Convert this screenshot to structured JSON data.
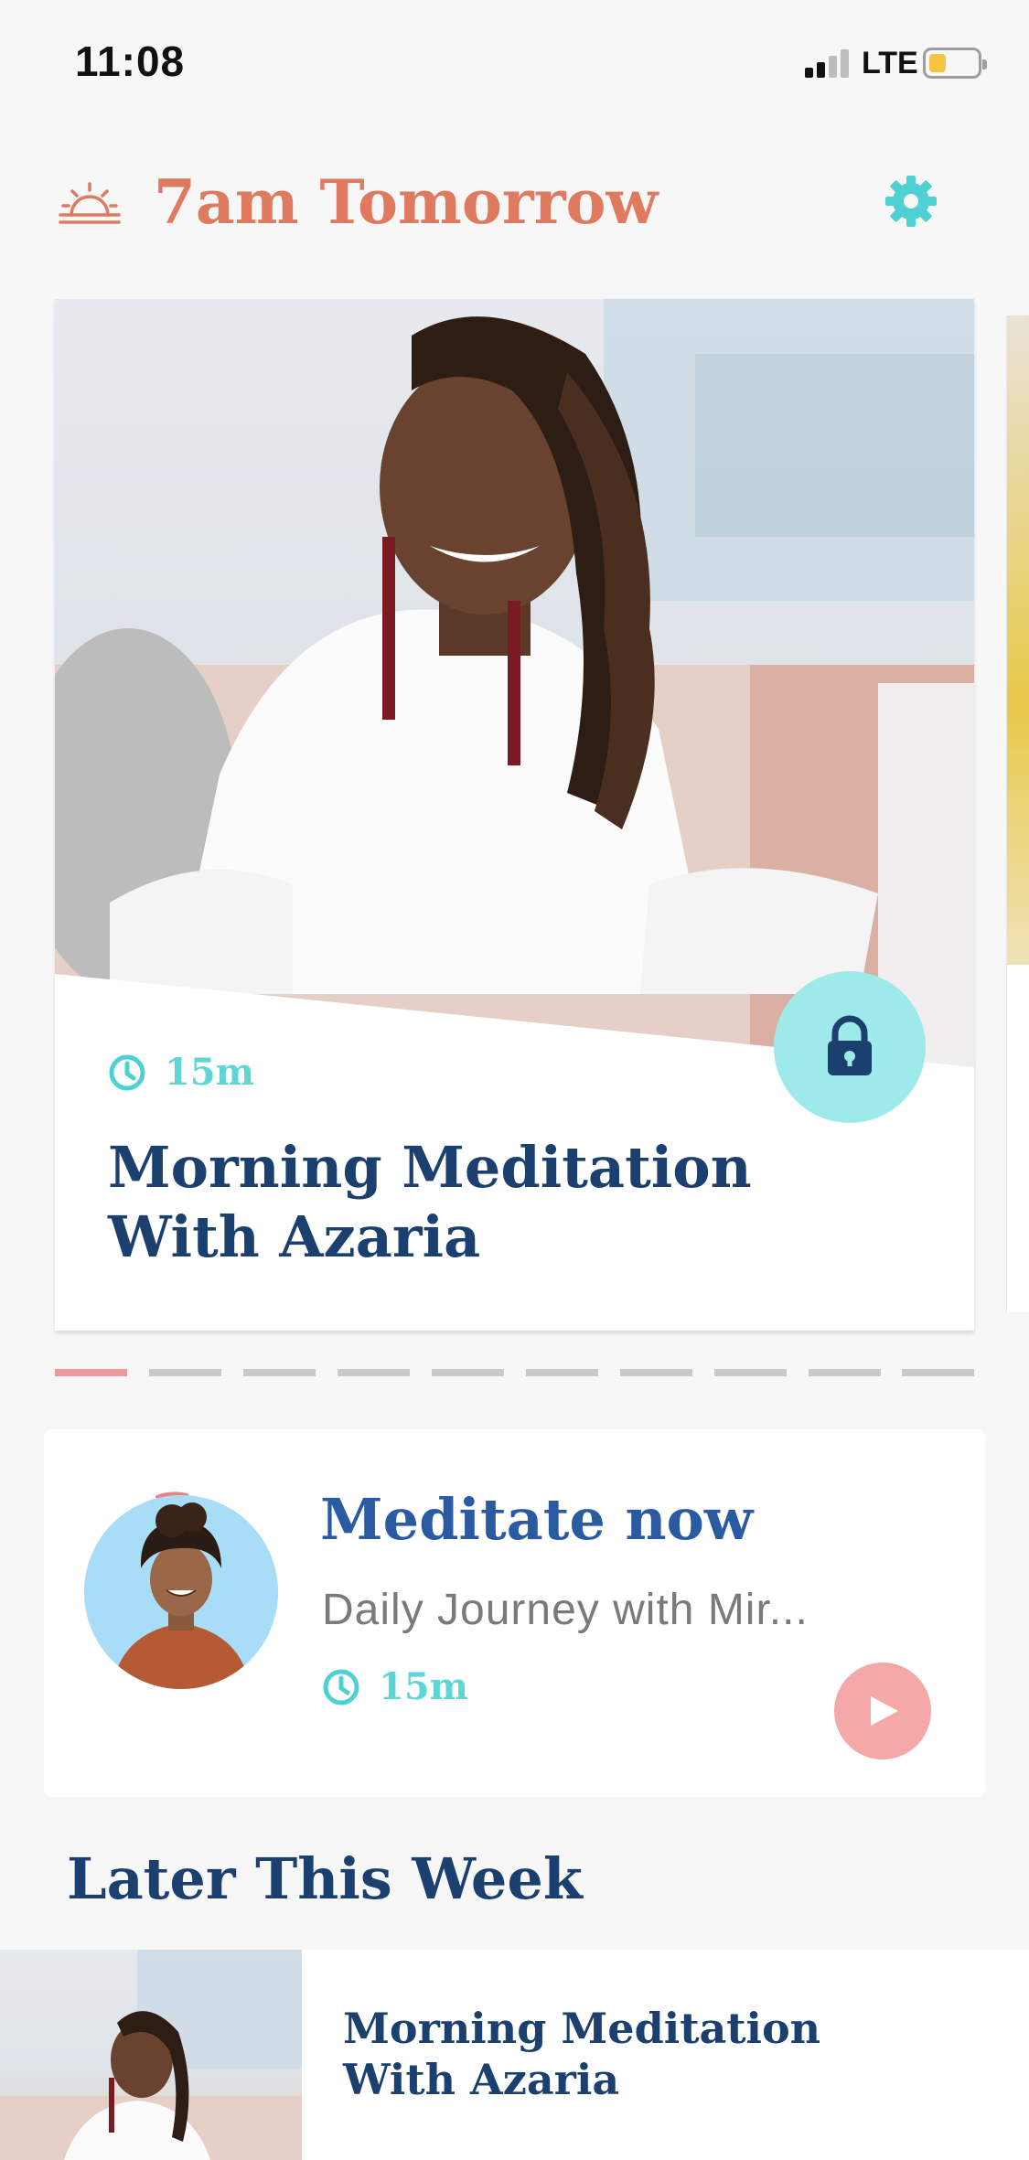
{
  "status_bar": {
    "time": "11:08",
    "network": "LTE",
    "signal_bars": 2,
    "battery_level": 0.35
  },
  "header": {
    "alarm_title": "7am Tomorrow",
    "sunrise_icon": "sunrise-icon",
    "settings_icon": "gear-icon",
    "accent_color": "#e07a5f",
    "icon_color": "#4fd0d3"
  },
  "featured": {
    "duration": "15m",
    "title_line1": "Morning Meditation",
    "title_line2": "With Azaria",
    "lock_icon": "lock-icon",
    "active_page": 1,
    "page_count": 10
  },
  "meditate_now": {
    "title": "Meditate now",
    "subtitle": "Daily Journey with Mir...",
    "duration": "15m",
    "play_icon": "play-icon",
    "title_color": "#2a5aa2"
  },
  "later": {
    "section_title": "Later This Week",
    "items": [
      {
        "title_line1": "Morning Meditation",
        "title_line2": "With Azaria"
      }
    ]
  }
}
